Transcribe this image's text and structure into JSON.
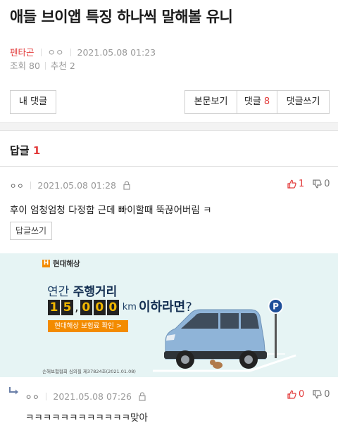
{
  "post": {
    "title": "애들 브이앱 특징 하나씩 말해볼 유니",
    "category": "펜타곤",
    "author": "ㅇㅇ",
    "datetime": "2021.05.08 01:23",
    "views_label": "조회",
    "views": "80",
    "recommend_label": "추천",
    "recommend": "2"
  },
  "toolbar": {
    "my_comments": "내 댓글",
    "view_body": "본문보기",
    "comments_label": "댓글",
    "comments_count": "8",
    "write_comment": "댓글쓰기"
  },
  "replies": {
    "label": "답글",
    "count": "1"
  },
  "comments": [
    {
      "author": "ㅇㅇ",
      "datetime": "2021.05.08 01:28",
      "upvotes": "1",
      "downvotes": "0",
      "text": "후이 엄청엄청 다정함 근데 빠이할때 뚝끊어버림 ㅋ",
      "reply_button": "답글쓰기"
    },
    {
      "author": "ㅇㅇ",
      "datetime": "2021.05.08 07:26",
      "upvotes": "0",
      "downvotes": "0",
      "text": "ㅋㅋㅋㅋㅋㅋㅋㅋㅋㅋㅋㅋ맞아"
    }
  ],
  "ad": {
    "brand": "현대해상",
    "line1_prefix": "연간",
    "line1_bold": "주행거리",
    "digits": [
      "1",
      "5",
      "0",
      "0",
      "0"
    ],
    "unit": "km",
    "suffix": "이하라면",
    "question_mark": "?",
    "cta": "현대해상 보험료 확인 >",
    "disclaimer": "손해보험협회 심의필 제37824호(2021.01.08)",
    "parking_letter": "P"
  },
  "colors": {
    "accent_red": "#e23a3a",
    "ad_background": "#e6f4f4",
    "ad_orange": "#f38b00",
    "car_blue": "#8fb4d8"
  }
}
